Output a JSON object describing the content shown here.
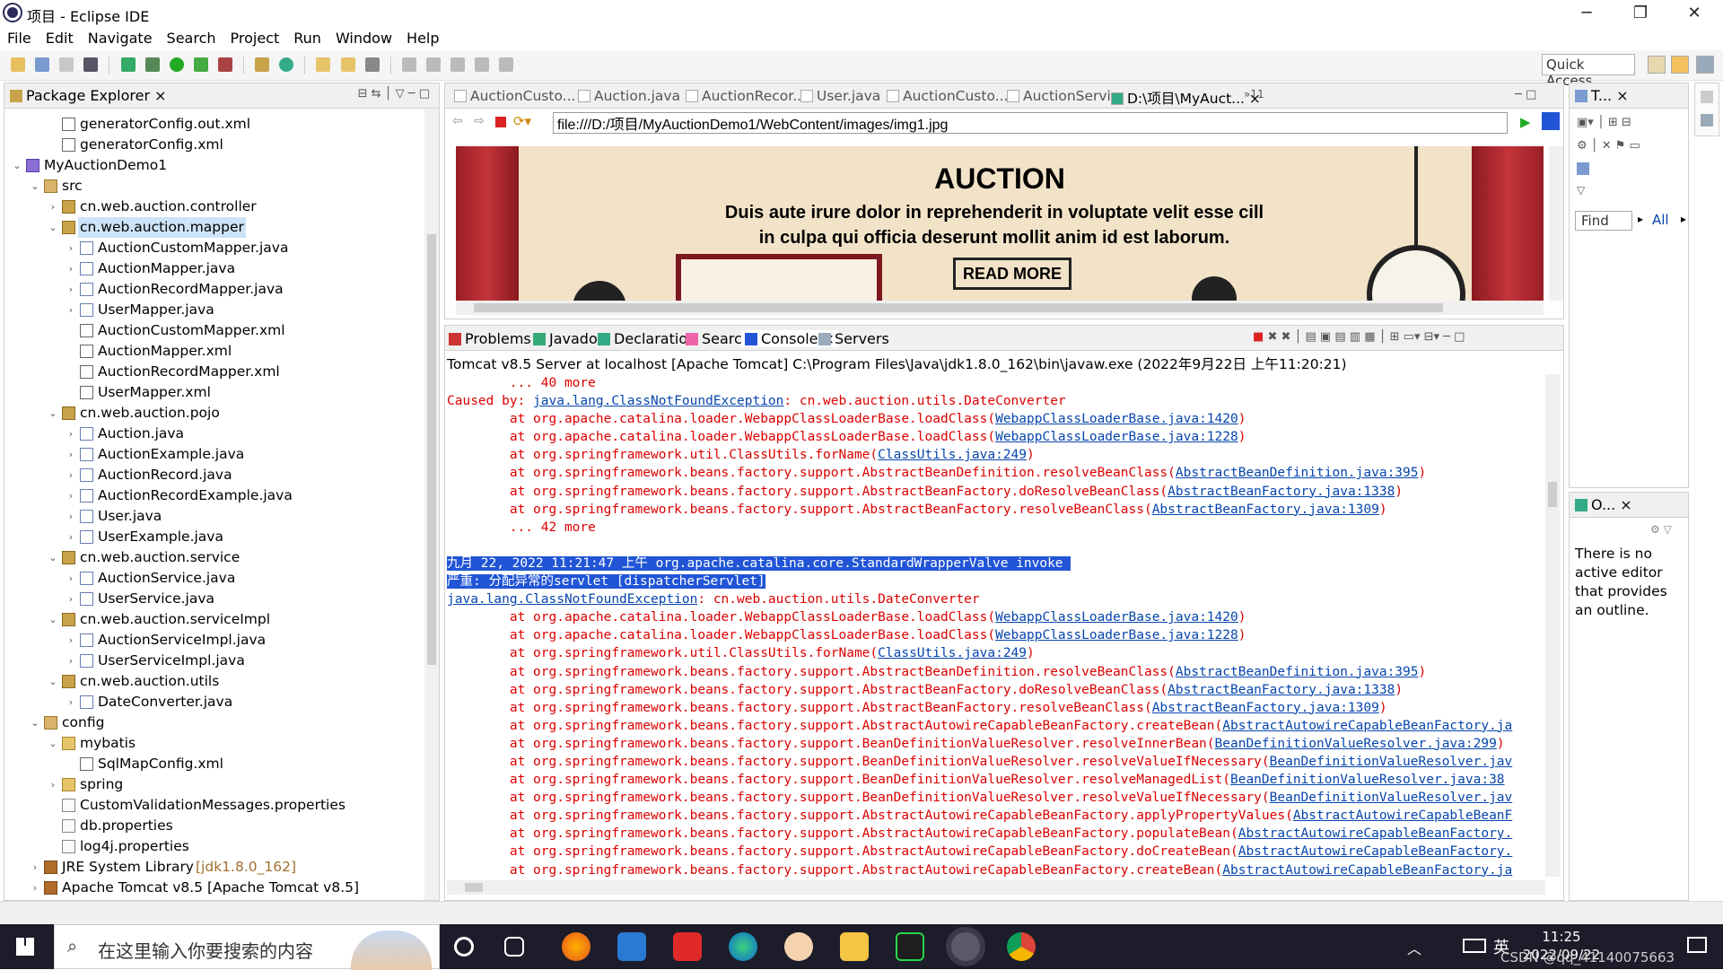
{
  "window": {
    "title": "项目 - Eclipse IDE",
    "minimize": "─",
    "maximize": "❐",
    "close": "✕"
  },
  "menu": [
    "File",
    "Edit",
    "Navigate",
    "Search",
    "Project",
    "Run",
    "Window",
    "Help"
  ],
  "toolbar": {
    "quick_access_placeholder": "Quick Access"
  },
  "package_explorer": {
    "title": "Package Explorer",
    "tree": [
      {
        "label": "generatorConfig.out.xml",
        "indent": 2,
        "icon": "xml-file-icon",
        "arrow": ""
      },
      {
        "label": "generatorConfig.xml",
        "indent": 2,
        "icon": "xml-file-icon",
        "arrow": ""
      },
      {
        "label": "MyAuctionDemo1",
        "indent": 0,
        "icon": "project-icon",
        "arrow": "v"
      },
      {
        "label": "src",
        "indent": 1,
        "icon": "source-folder-icon",
        "arrow": "v"
      },
      {
        "label": "cn.web.auction.controller",
        "indent": 2,
        "icon": "package-icon",
        "arrow": ">"
      },
      {
        "label": "cn.web.auction.mapper",
        "indent": 2,
        "icon": "package-icon",
        "arrow": "v",
        "selected": true
      },
      {
        "label": "AuctionCustomMapper.java",
        "indent": 3,
        "icon": "java-file-icon",
        "arrow": ">"
      },
      {
        "label": "AuctionMapper.java",
        "indent": 3,
        "icon": "java-file-icon",
        "arrow": ">"
      },
      {
        "label": "AuctionRecordMapper.java",
        "indent": 3,
        "icon": "java-file-icon",
        "arrow": ">"
      },
      {
        "label": "UserMapper.java",
        "indent": 3,
        "icon": "java-file-icon",
        "arrow": ">"
      },
      {
        "label": "AuctionCustomMapper.xml",
        "indent": 3,
        "icon": "xml-file-icon",
        "arrow": ""
      },
      {
        "label": "AuctionMapper.xml",
        "indent": 3,
        "icon": "xml-file-icon",
        "arrow": ""
      },
      {
        "label": "AuctionRecordMapper.xml",
        "indent": 3,
        "icon": "xml-file-icon",
        "arrow": ""
      },
      {
        "label": "UserMapper.xml",
        "indent": 3,
        "icon": "xml-file-icon",
        "arrow": ""
      },
      {
        "label": "cn.web.auction.pojo",
        "indent": 2,
        "icon": "package-icon",
        "arrow": "v"
      },
      {
        "label": "Auction.java",
        "indent": 3,
        "icon": "java-file-icon",
        "arrow": ">"
      },
      {
        "label": "AuctionExample.java",
        "indent": 3,
        "icon": "java-file-icon",
        "arrow": ">"
      },
      {
        "label": "AuctionRecord.java",
        "indent": 3,
        "icon": "java-file-icon",
        "arrow": ">"
      },
      {
        "label": "AuctionRecordExample.java",
        "indent": 3,
        "icon": "java-file-icon",
        "arrow": ">"
      },
      {
        "label": "User.java",
        "indent": 3,
        "icon": "java-file-icon",
        "arrow": ">"
      },
      {
        "label": "UserExample.java",
        "indent": 3,
        "icon": "java-file-icon",
        "arrow": ">"
      },
      {
        "label": "cn.web.auction.service",
        "indent": 2,
        "icon": "package-icon",
        "arrow": "v"
      },
      {
        "label": "AuctionService.java",
        "indent": 3,
        "icon": "java-file-icon",
        "arrow": ">"
      },
      {
        "label": "UserService.java",
        "indent": 3,
        "icon": "java-file-icon",
        "arrow": ">"
      },
      {
        "label": "cn.web.auction.serviceImpl",
        "indent": 2,
        "icon": "package-icon",
        "arrow": "v"
      },
      {
        "label": "AuctionServiceImpl.java",
        "indent": 3,
        "icon": "java-file-icon",
        "arrow": ">"
      },
      {
        "label": "UserServiceImpl.java",
        "indent": 3,
        "icon": "java-file-icon",
        "arrow": ">"
      },
      {
        "label": "cn.web.auction.utils",
        "indent": 2,
        "icon": "package-icon",
        "arrow": "v"
      },
      {
        "label": "DateConverter.java",
        "indent": 3,
        "icon": "java-file-icon",
        "arrow": ">"
      },
      {
        "label": "config",
        "indent": 1,
        "icon": "source-folder-icon",
        "arrow": "v"
      },
      {
        "label": "mybatis",
        "indent": 2,
        "icon": "folder-package-icon",
        "arrow": "v"
      },
      {
        "label": "SqlMapConfig.xml",
        "indent": 3,
        "icon": "xml-file-icon",
        "arrow": ""
      },
      {
        "label": "spring",
        "indent": 2,
        "icon": "folder-package-icon",
        "arrow": ">"
      },
      {
        "label": "CustomValidationMessages.properties",
        "indent": 2,
        "icon": "properties-file-icon",
        "arrow": ""
      },
      {
        "label": "db.properties",
        "indent": 2,
        "icon": "properties-file-icon",
        "arrow": ""
      },
      {
        "label": "log4j.properties",
        "indent": 2,
        "icon": "properties-file-icon",
        "arrow": ""
      },
      {
        "label": "JRE System Library",
        "suffix": " [jdk1.8.0_162]",
        "indent": 1,
        "icon": "library-icon",
        "arrow": ">"
      },
      {
        "label": "Apache Tomcat v8.5 [Apache Tomcat v8.5]",
        "indent": 1,
        "icon": "library-icon",
        "arrow": ">"
      }
    ]
  },
  "editor": {
    "tabs": [
      "AuctionCusto...",
      "Auction.java",
      "AuctionRecor...",
      "User.java",
      "AuctionCusto...",
      "AuctionServi...",
      "D:\\项目\\MyAuct..."
    ],
    "overflow": "»11",
    "url": "file:///D:/项目/MyAuctionDemo1/WebContent/images/img1.jpg",
    "banner": {
      "title": "AUCTION",
      "line1": "Duis aute irure dolor in reprehenderit in voluptate velit esse cill",
      "line2": "in culpa qui officia deserunt mollit anim id est laborum.",
      "button": "READ MORE"
    }
  },
  "console": {
    "tabs": [
      "Problems",
      "Javadoc",
      "Declaration",
      "Search",
      "Console",
      "Servers"
    ],
    "header": "Tomcat v8.5 Server at localhost [Apache Tomcat] C:\\Program Files\\Java\\jdk1.8.0_162\\bin\\javaw.exe (2022年9月22日 上午11:20:21)",
    "lines": [
      {
        "pre": "\t... 40 more"
      },
      {
        "pre": "Caused by: ",
        "link": "java.lang.ClassNotFoundException",
        "post": ": cn.web.auction.utils.DateConverter"
      },
      {
        "pre": "\tat org.apache.catalina.loader.WebappClassLoaderBase.loadClass(",
        "link": "WebappClassLoaderBase.java:1420",
        "post": ")"
      },
      {
        "pre": "\tat org.apache.catalina.loader.WebappClassLoaderBase.loadClass(",
        "link": "WebappClassLoaderBase.java:1228",
        "post": ")"
      },
      {
        "pre": "\tat org.springframework.util.ClassUtils.forName(",
        "link": "ClassUtils.java:249",
        "post": ")"
      },
      {
        "pre": "\tat org.springframework.beans.factory.support.AbstractBeanDefinition.resolveBeanClass(",
        "link": "AbstractBeanDefinition.java:395",
        "post": ")"
      },
      {
        "pre": "\tat org.springframework.beans.factory.support.AbstractBeanFactory.doResolveBeanClass(",
        "link": "AbstractBeanFactory.java:1338",
        "post": ")"
      },
      {
        "pre": "\tat org.springframework.beans.factory.support.AbstractBeanFactory.resolveBeanClass(",
        "link": "AbstractBeanFactory.java:1309",
        "post": ")"
      },
      {
        "pre": "\t... 42 more"
      },
      {
        "pre": ""
      },
      {
        "pre": "九月 22, 2022 11:21:47 上午 org.apache.catalina.core.StandardWrapperValve invoke ",
        "highlight": true
      },
      {
        "pre": "严重: 分配异常的servlet [dispatcherServlet]",
        "highlight": true
      },
      {
        "pre": "",
        "link": "java.lang.ClassNotFoundException",
        "post": ": cn.web.auction.utils.DateConverter"
      },
      {
        "pre": "\tat org.apache.catalina.loader.WebappClassLoaderBase.loadClass(",
        "link": "WebappClassLoaderBase.java:1420",
        "post": ")"
      },
      {
        "pre": "\tat org.apache.catalina.loader.WebappClassLoaderBase.loadClass(",
        "link": "WebappClassLoaderBase.java:1228",
        "post": ")"
      },
      {
        "pre": "\tat org.springframework.util.ClassUtils.forName(",
        "link": "ClassUtils.java:249",
        "post": ")"
      },
      {
        "pre": "\tat org.springframework.beans.factory.support.AbstractBeanDefinition.resolveBeanClass(",
        "link": "AbstractBeanDefinition.java:395",
        "post": ")"
      },
      {
        "pre": "\tat org.springframework.beans.factory.support.AbstractBeanFactory.doResolveBeanClass(",
        "link": "AbstractBeanFactory.java:1338",
        "post": ")"
      },
      {
        "pre": "\tat org.springframework.beans.factory.support.AbstractBeanFactory.resolveBeanClass(",
        "link": "AbstractBeanFactory.java:1309",
        "post": ")"
      },
      {
        "pre": "\tat org.springframework.beans.factory.support.AbstractAutowireCapableBeanFactory.createBean(",
        "link": "AbstractAutowireCapableBeanFactory.ja",
        "post": ""
      },
      {
        "pre": "\tat org.springframework.beans.factory.support.BeanDefinitionValueResolver.resolveInnerBean(",
        "link": "BeanDefinitionValueResolver.java:299",
        "post": ")"
      },
      {
        "pre": "\tat org.springframework.beans.factory.support.BeanDefinitionValueResolver.resolveValueIfNecessary(",
        "link": "BeanDefinitionValueResolver.jav",
        "post": ""
      },
      {
        "pre": "\tat org.springframework.beans.factory.support.BeanDefinitionValueResolver.resolveManagedList(",
        "link": "BeanDefinitionValueResolver.java:38",
        "post": ""
      },
      {
        "pre": "\tat org.springframework.beans.factory.support.BeanDefinitionValueResolver.resolveValueIfNecessary(",
        "link": "BeanDefinitionValueResolver.jav",
        "post": ""
      },
      {
        "pre": "\tat org.springframework.beans.factory.support.AbstractAutowireCapableBeanFactory.applyPropertyValues(",
        "link": "AbstractAutowireCapableBeanF",
        "post": ""
      },
      {
        "pre": "\tat org.springframework.beans.factory.support.AbstractAutowireCapableBeanFactory.populateBean(",
        "link": "AbstractAutowireCapableBeanFactory.",
        "post": ""
      },
      {
        "pre": "\tat org.springframework.beans.factory.support.AbstractAutowireCapableBeanFactory.doCreateBean(",
        "link": "AbstractAutowireCapableBeanFactory.",
        "post": ""
      },
      {
        "pre": "\tat org.springframework.beans.factory.support.AbstractAutowireCapableBeanFactory.createBean(",
        "link": "AbstractAutowireCapableBeanFactory.ja",
        "post": ""
      }
    ]
  },
  "task_list": {
    "title": "T...",
    "find_placeholder": "Find",
    "all_label": "All"
  },
  "outline": {
    "title": "O...",
    "message": "There is no active editor that provides an outline."
  },
  "taskbar": {
    "search_placeholder": "在这里输入你要搜索的内容",
    "time": "11:25",
    "date": "2022/09/22",
    "ime": "英",
    "watermark": "CSDN @qq_41140075663"
  },
  "colors": {
    "selection": "#cde3f7",
    "console_error": "#dd0000",
    "link": "#0645ad",
    "highlight": "#2155d6"
  }
}
